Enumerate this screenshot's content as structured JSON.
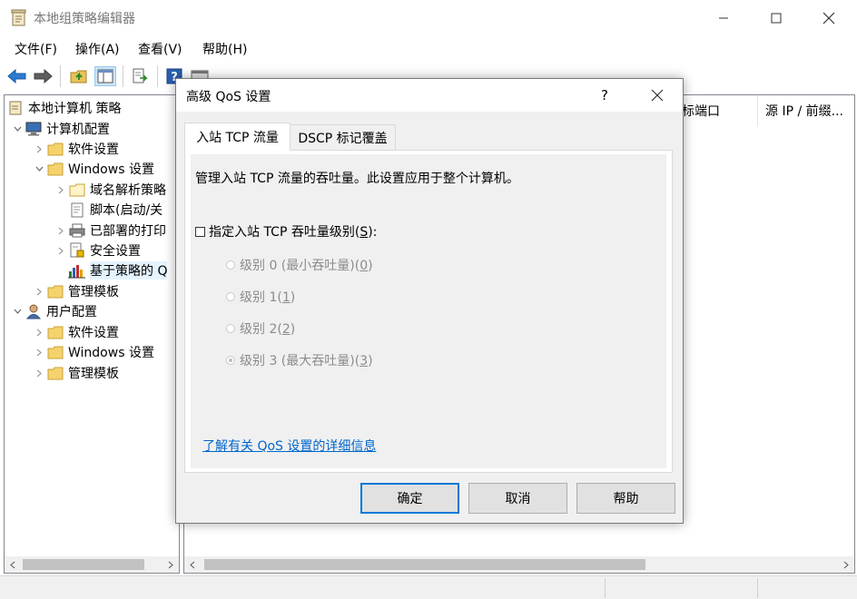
{
  "window": {
    "title": "本地组策略编辑器"
  },
  "menu": [
    "文件(F)",
    "操作(A)",
    "查看(V)",
    "帮助(H)"
  ],
  "toolbar": {
    "icons": [
      "back-icon",
      "forward-icon",
      "up-folder-icon",
      "show-hide-tree-icon",
      "export-list-icon",
      "help-icon",
      "properties-icon"
    ]
  },
  "tree": {
    "root": "本地计算机 策略",
    "computer_config": "计算机配置",
    "software_settings": "软件设置",
    "windows_settings": "Windows 设置",
    "name_resolution": "域名解析策略",
    "scripts": "脚本(启动/关",
    "deployed_printers": "已部署的打印",
    "security_settings": "安全设置",
    "policy_qos": "基于策略的 Q",
    "admin_templates": "管理模板",
    "user_config": "用户配置",
    "user_software_settings": "软件设置",
    "user_windows_settings": "Windows 设置",
    "user_admin_templates": "管理模板"
  },
  "list": {
    "columns": [
      "标端口",
      "源 IP / 前缀..."
    ]
  },
  "dialog": {
    "title": "高级 QoS 设置",
    "help_glyph": "?",
    "tabs": [
      "入站 TCP 流量",
      "DSCP 标记覆盖"
    ],
    "description": "管理入站 TCP 流量的吞吐量。此设置应用于整个计算机。",
    "checkbox": {
      "label_before": "指定入站 TCP 吞吐量级别(",
      "accel": "S",
      "label_after": "):",
      "checked": false
    },
    "levels": [
      {
        "before": "级别 0 (最小吞吐量)(",
        "accel": "0",
        "after": ")",
        "selected": false
      },
      {
        "before": "级别 1(",
        "accel": "1",
        "after": ")",
        "selected": false
      },
      {
        "before": "级别 2(",
        "accel": "2",
        "after": ")",
        "selected": false
      },
      {
        "before": "级别 3 (最大吞吐量)(",
        "accel": "3",
        "after": ")",
        "selected": true
      }
    ],
    "link": "了解有关 QoS 设置的详细信息",
    "buttons": {
      "ok": "确定",
      "cancel": "取消",
      "help": "帮助"
    }
  },
  "colors": {
    "link": "#0066cc",
    "selection": "#e5f3ff",
    "default_button_border": "#0078d7"
  }
}
